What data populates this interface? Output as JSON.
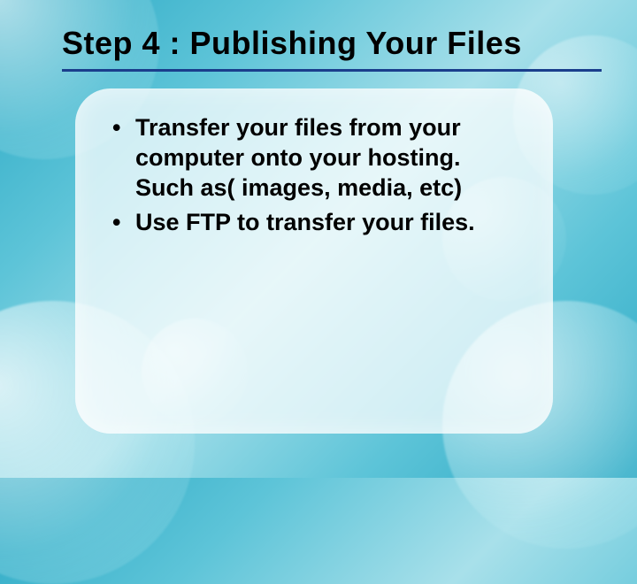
{
  "slide": {
    "title": "Step 4 : Publishing Your Files",
    "bullets": [
      "Transfer your files from your computer onto your hosting. Such as( images, media, etc)",
      "Use FTP to transfer your files."
    ]
  }
}
